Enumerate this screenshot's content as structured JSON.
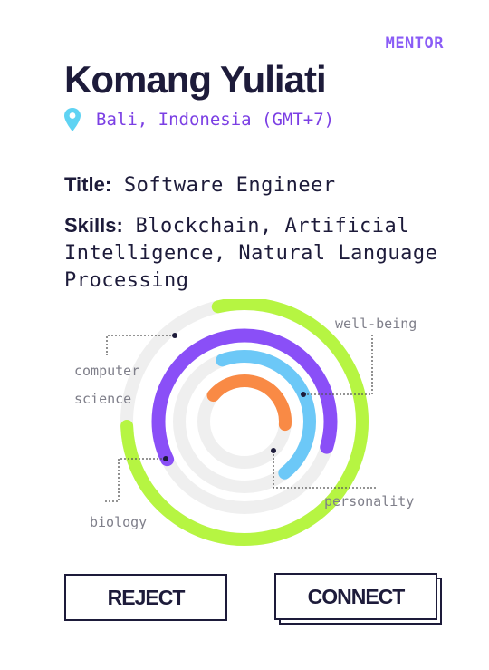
{
  "profile": {
    "role_badge": "MENTOR",
    "name": "Komang Yuliati",
    "location": "Bali, Indonesia (GMT+7)",
    "title_label": "Title:",
    "title_value": "Software Engineer",
    "skills_label": "Skills:",
    "skills_value": "Blockchain, Artificial Intelligence, Natural Language Processing"
  },
  "icons": {
    "location": "map-pin-icon"
  },
  "chart_data": {
    "type": "radial-bar",
    "series": [
      {
        "label": "computer science",
        "value": 0.78,
        "color": "#b6f542"
      },
      {
        "label": "biology",
        "value": 0.62,
        "color": "#8a4ff7"
      },
      {
        "label": "well-being",
        "value": 0.45,
        "color": "#6cc8f7"
      },
      {
        "label": "personality",
        "value": 0.4,
        "color": "#f98a45"
      }
    ],
    "track_color": "#efefef"
  },
  "labels": {
    "computer_line1": "computer",
    "computer_line2": "science",
    "wellbeing": "well-being",
    "biology": "biology",
    "personality": "personality"
  },
  "buttons": {
    "reject": "REJECT",
    "connect": "CONNECT"
  },
  "colors": {
    "ink": "#1d1b3a",
    "accent": "#8a5cf6",
    "location_text": "#7b3fe4",
    "pin": "#5fd3f3"
  }
}
